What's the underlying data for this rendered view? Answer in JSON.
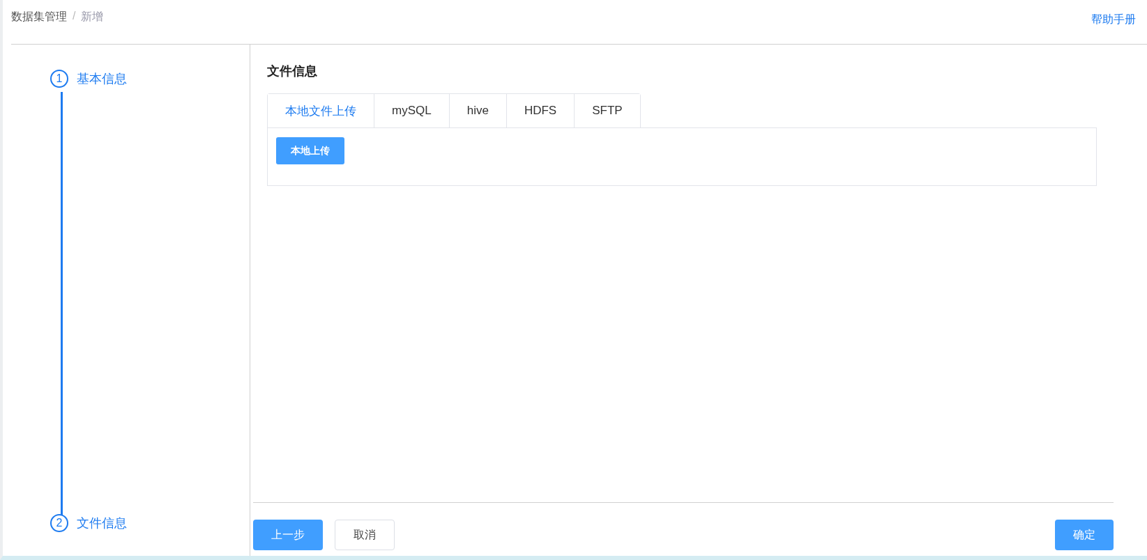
{
  "breadcrumb": [
    {
      "label": "数据集管理",
      "current": false
    },
    {
      "label": "新增",
      "current": true
    }
  ],
  "breadcrumb_separator": "/",
  "help_link": "帮助手册",
  "steps": [
    {
      "number": "1",
      "label": "基本信息"
    },
    {
      "number": "2",
      "label": "文件信息"
    }
  ],
  "section_title": "文件信息",
  "tabs": [
    {
      "label": "本地文件上传",
      "selected": true
    },
    {
      "label": "mySQL",
      "selected": false
    },
    {
      "label": "hive",
      "selected": false
    },
    {
      "label": "HDFS",
      "selected": false
    },
    {
      "label": "SFTP",
      "selected": false
    }
  ],
  "upload_button": "本地上传",
  "footer": {
    "prev_button": "上一步",
    "cancel_button": "取消",
    "confirm_button": "确定"
  }
}
